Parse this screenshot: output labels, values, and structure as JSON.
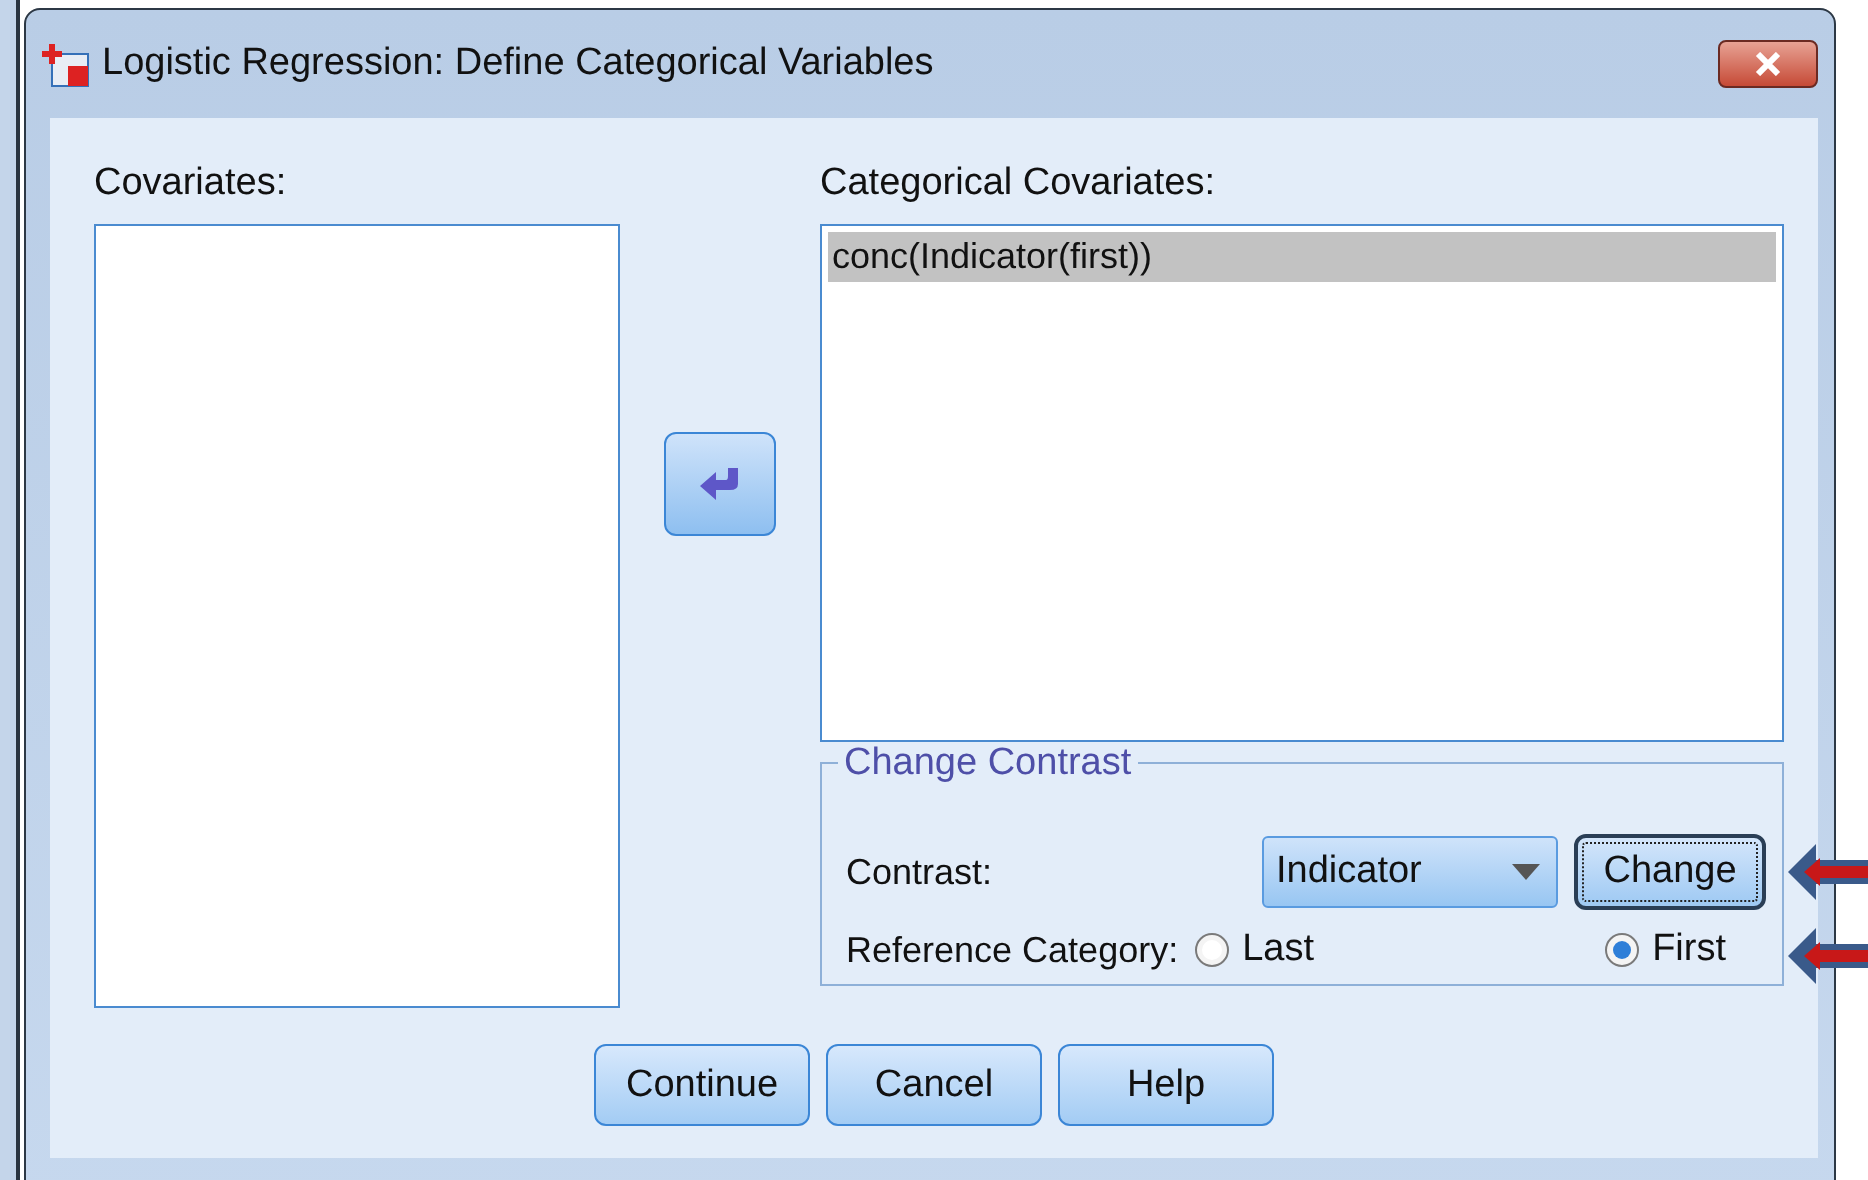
{
  "window": {
    "title": "Logistic Regression: Define Categorical Variables"
  },
  "covariates": {
    "label": "Covariates:"
  },
  "categorical": {
    "label": "Categorical Covariates:",
    "items": [
      {
        "text": "conc(Indicator(first))",
        "selected": true
      }
    ]
  },
  "change_contrast": {
    "title": "Change Contrast",
    "contrast_label": "Contrast:",
    "contrast_value": "Indicator",
    "change_button": "Change",
    "reference_label": "Reference Category:",
    "options": [
      {
        "label": "Last",
        "selected": false
      },
      {
        "label": "First",
        "selected": true
      }
    ]
  },
  "buttons": [
    "Continue",
    "Cancel",
    "Help"
  ]
}
